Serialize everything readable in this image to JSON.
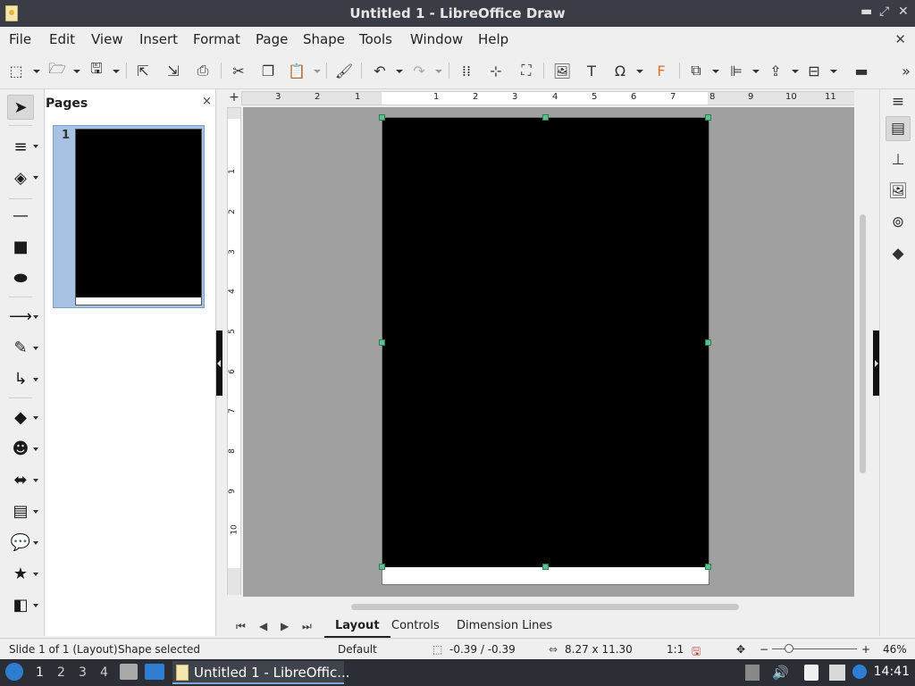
{
  "window": {
    "title": "Untitled 1 - LibreOffice Draw"
  },
  "menu": [
    "File",
    "Edit",
    "View",
    "Insert",
    "Format",
    "Page",
    "Shape",
    "Tools",
    "Window",
    "Help"
  ],
  "pages_panel": {
    "title": "Pages",
    "close_glyph": "×",
    "page_number": "1"
  },
  "hruler": {
    "labels": [
      "3",
      "2",
      "1",
      "1",
      "2",
      "3",
      "4",
      "5",
      "6",
      "7",
      "8",
      "9",
      "10",
      "11"
    ]
  },
  "vruler": {
    "labels": [
      "1",
      "2",
      "3",
      "4",
      "5",
      "6",
      "7",
      "8",
      "9",
      "10"
    ]
  },
  "layer_tabs": {
    "layout": "Layout",
    "controls": "Controls",
    "dimension_lines": "Dimension Lines"
  },
  "status": {
    "slide": "Slide 1 of 1 (Layout)",
    "selection": "Shape selected",
    "master": "Default",
    "position": "-0.39 / -0.39",
    "size": "8.27 x 11.30",
    "scale": "1:1",
    "zoom": "46%"
  },
  "taskbar": {
    "workspaces": [
      "1",
      "2",
      "3",
      "4"
    ],
    "task_label": "Untitled 1 - LibreOffic...",
    "clock": "14:41"
  },
  "colors": {
    "selection_handle": "#5fbf8f",
    "shape_fill": "#000000",
    "canvas_bg": "#a0a0a0"
  }
}
